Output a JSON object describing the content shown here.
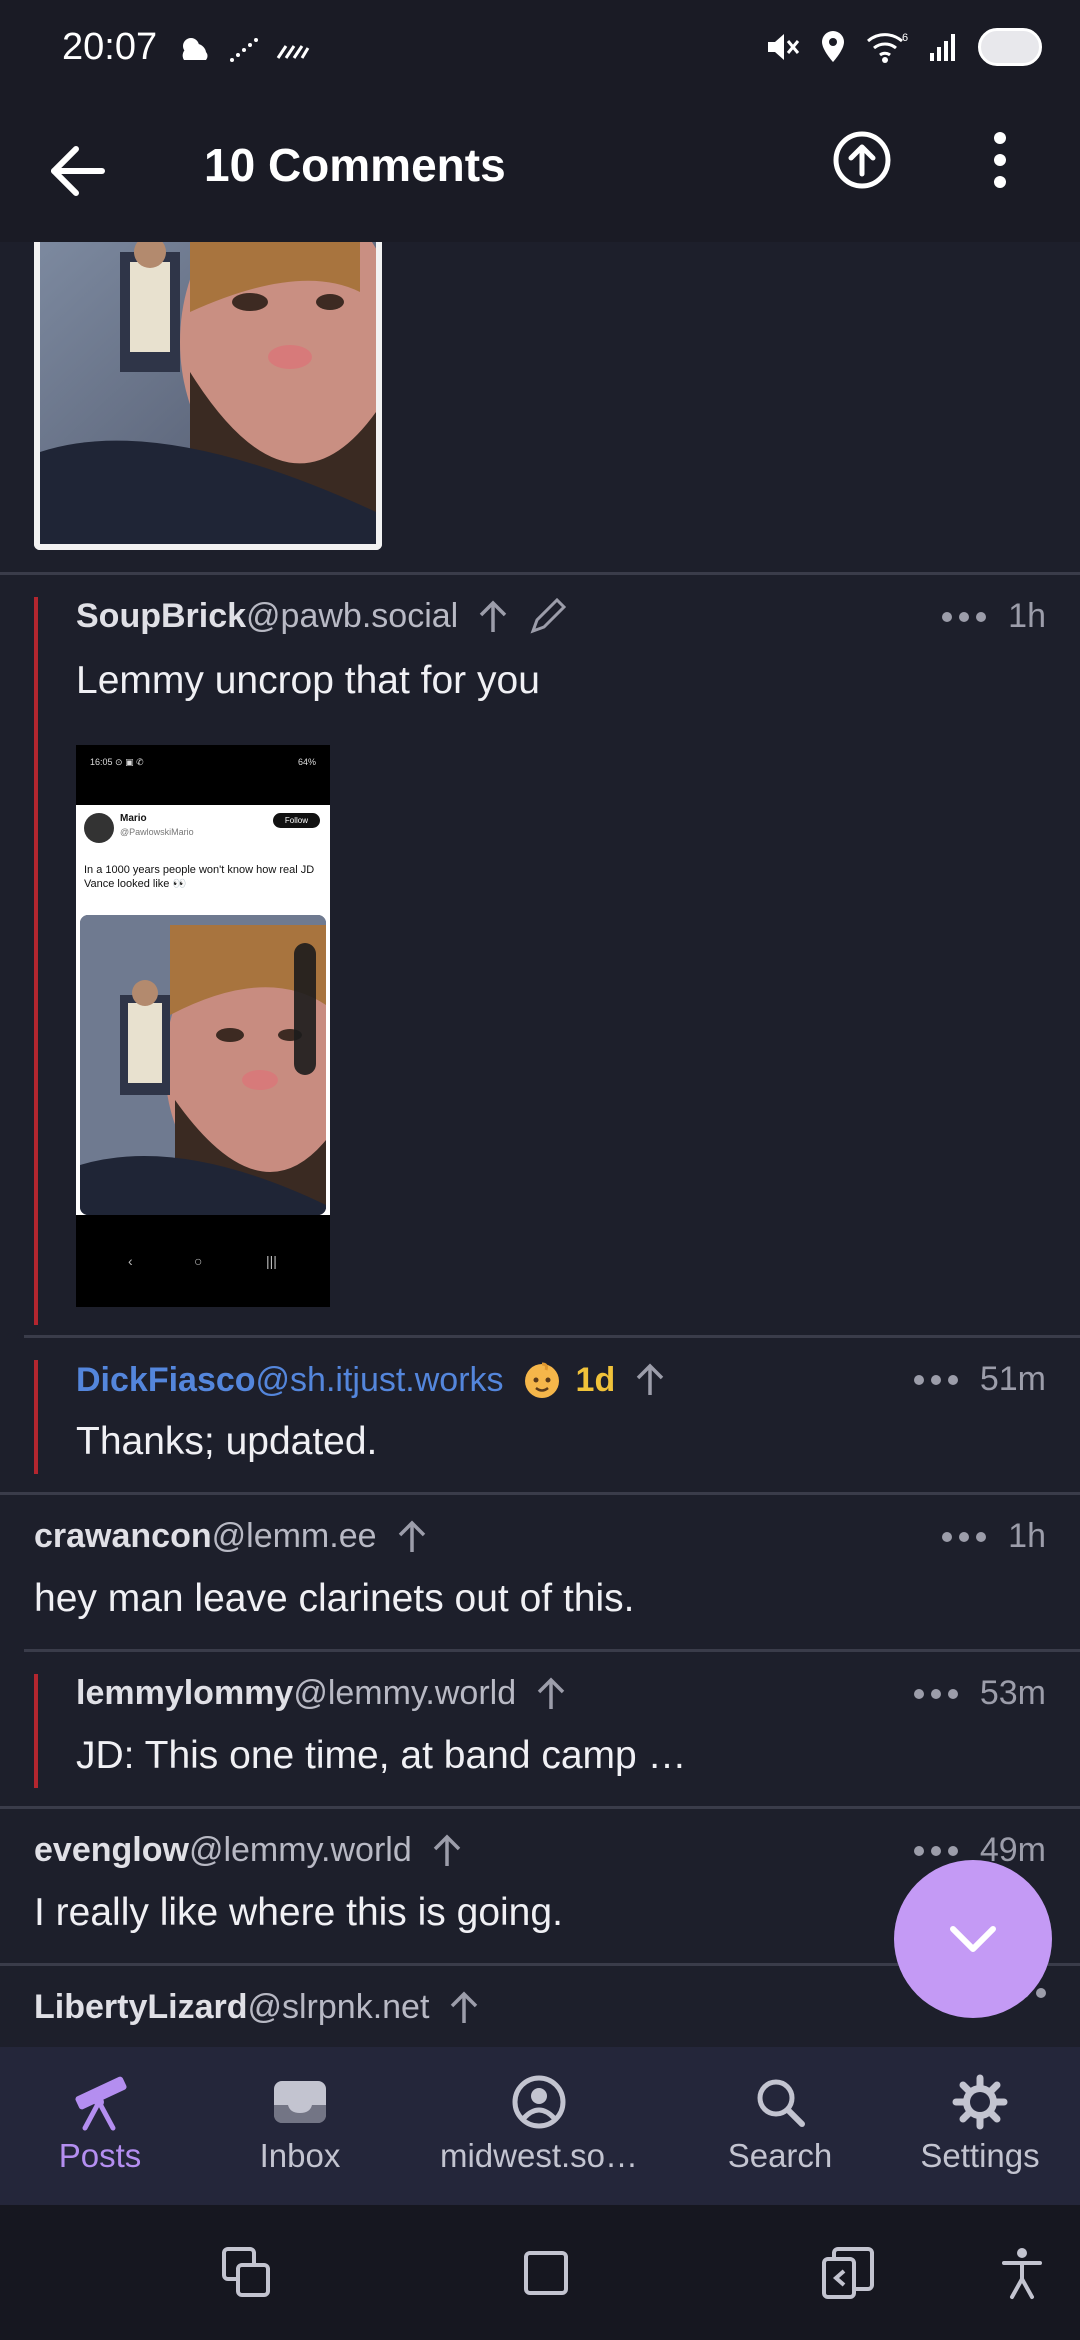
{
  "status_bar": {
    "time": "20:07",
    "left_icons": [
      "weather-cloud-icon",
      "dotted-line-icon",
      "signal-hatch-icon"
    ],
    "right_icons": [
      "mute-icon",
      "location-icon",
      "wifi-6-icon",
      "cell-signal-icon",
      "battery-icon"
    ]
  },
  "app_bar": {
    "title": "10 Comments",
    "back_icon": "arrow-left-icon",
    "action_icons": [
      "upload-circle-icon",
      "more-vertical-icon"
    ]
  },
  "comments": [
    {
      "user": "SoupBrick",
      "instance": "@pawb.social",
      "time": "1h",
      "body": "Lemmy uncrop that for you",
      "has_image": true,
      "edited": true,
      "depth": 1
    },
    {
      "user": "DickFiasco",
      "instance": "@sh.itjust.works",
      "cake_age": "1d",
      "time": "51m",
      "body": "Thanks; updated.",
      "depth": 1,
      "is_op": true
    },
    {
      "user": "crawancon",
      "instance": "@lemm.ee",
      "time": "1h",
      "body": "hey man leave clarinets out of this.",
      "depth": 0
    },
    {
      "user": "lemmylommy",
      "instance": "@lemmy.world",
      "time": "53m",
      "body": "JD: This one time, at band camp …",
      "depth": 1
    },
    {
      "user": "evenglow",
      "instance": "@lemmy.world",
      "time": "49m",
      "body": "I really like where this is going.",
      "depth": 0
    },
    {
      "user": "LibertyLizard",
      "instance": "@slrpnk.net",
      "time": "",
      "body": "",
      "depth": 0
    }
  ],
  "embedded_screenshot": {
    "status_text": "16:05 ⊙ ▣ ✆",
    "status_right": "64%",
    "name": "Mario",
    "handle": "@PawlowskiMario",
    "follow": "Follow",
    "text": "In a 1000 years people won't know how real JD Vance looked like 👀",
    "nav": [
      "‹",
      "○",
      "|||"
    ]
  },
  "fab": {
    "icon": "chevron-down-icon"
  },
  "bottom_nav": [
    {
      "label": "Posts",
      "icon": "telescope-icon",
      "active": true
    },
    {
      "label": "Inbox",
      "icon": "inbox-icon",
      "active": false
    },
    {
      "label": "midwest.so…",
      "icon": "account-circle-icon",
      "active": false
    },
    {
      "label": "Search",
      "icon": "search-icon",
      "active": false
    },
    {
      "label": "Settings",
      "icon": "gear-icon",
      "active": false
    }
  ],
  "system_nav": [
    "recent-apps-icon",
    "home-square-icon",
    "back-icon",
    "accessibility-icon"
  ],
  "colors": {
    "background": "#1d1f2b",
    "accent": "#c49af5",
    "thread_bar": "#b3262f",
    "op_user": "#5486dc",
    "cake": "#f0c23a"
  }
}
